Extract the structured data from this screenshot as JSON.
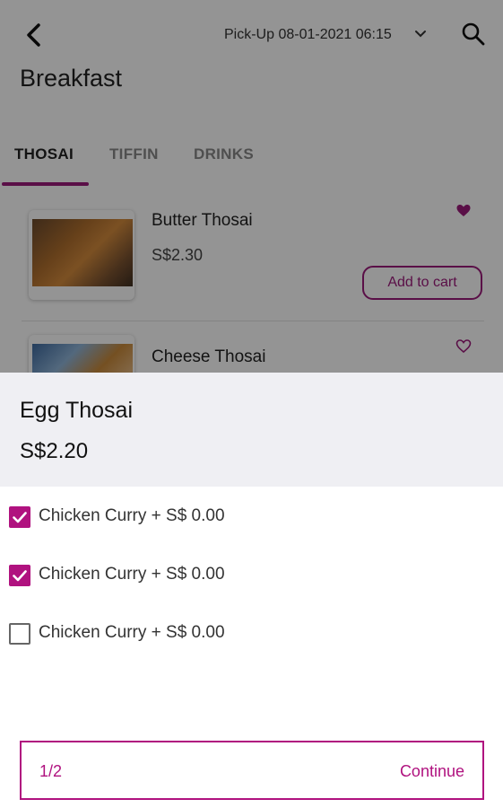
{
  "header": {
    "pickup_label": "Pick-Up 08-01-2021 06:15",
    "title": "Breakfast"
  },
  "tabs": [
    {
      "label": "THOSAI",
      "active": true
    },
    {
      "label": "TIFFIN",
      "active": false
    },
    {
      "label": "DRINKS",
      "active": false
    }
  ],
  "menu_items": [
    {
      "name": "Butter Thosai",
      "price": "S$2.30",
      "favorite": true,
      "cart_label": "Add to cart"
    },
    {
      "name": "Cheese Thosai",
      "favorite": false
    }
  ],
  "sheet": {
    "title": "Egg Thosai",
    "price": "S$2.20",
    "options": [
      {
        "label": "Chicken Curry + S$ 0.00",
        "checked": true
      },
      {
        "label": "Chicken Curry + S$ 0.00",
        "checked": true
      },
      {
        "label": "Chicken Curry + S$ 0.00",
        "checked": false
      }
    ],
    "step": "1/2",
    "continue_label": "Continue"
  },
  "colors": {
    "accent": "#b0127f",
    "tab_indicator": "#9c1a7b",
    "sheet_header_bg": "#efeff3"
  },
  "icons": [
    "back-arrow-icon",
    "chevron-down-icon",
    "search-icon",
    "heart-filled-icon",
    "heart-outline-icon",
    "checkbox-checked-icon"
  ]
}
